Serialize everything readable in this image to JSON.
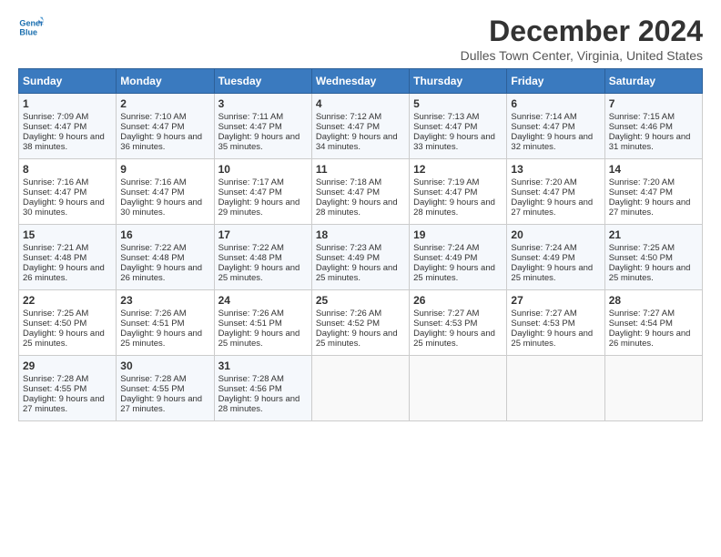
{
  "header": {
    "logo_line1": "General",
    "logo_line2": "Blue",
    "month_title": "December 2024",
    "location": "Dulles Town Center, Virginia, United States"
  },
  "days_of_week": [
    "Sunday",
    "Monday",
    "Tuesday",
    "Wednesday",
    "Thursday",
    "Friday",
    "Saturday"
  ],
  "rows": [
    [
      {
        "day": "1",
        "sunrise": "Sunrise: 7:09 AM",
        "sunset": "Sunset: 4:47 PM",
        "daylight": "Daylight: 9 hours and 38 minutes."
      },
      {
        "day": "2",
        "sunrise": "Sunrise: 7:10 AM",
        "sunset": "Sunset: 4:47 PM",
        "daylight": "Daylight: 9 hours and 36 minutes."
      },
      {
        "day": "3",
        "sunrise": "Sunrise: 7:11 AM",
        "sunset": "Sunset: 4:47 PM",
        "daylight": "Daylight: 9 hours and 35 minutes."
      },
      {
        "day": "4",
        "sunrise": "Sunrise: 7:12 AM",
        "sunset": "Sunset: 4:47 PM",
        "daylight": "Daylight: 9 hours and 34 minutes."
      },
      {
        "day": "5",
        "sunrise": "Sunrise: 7:13 AM",
        "sunset": "Sunset: 4:47 PM",
        "daylight": "Daylight: 9 hours and 33 minutes."
      },
      {
        "day": "6",
        "sunrise": "Sunrise: 7:14 AM",
        "sunset": "Sunset: 4:47 PM",
        "daylight": "Daylight: 9 hours and 32 minutes."
      },
      {
        "day": "7",
        "sunrise": "Sunrise: 7:15 AM",
        "sunset": "Sunset: 4:46 PM",
        "daylight": "Daylight: 9 hours and 31 minutes."
      }
    ],
    [
      {
        "day": "8",
        "sunrise": "Sunrise: 7:16 AM",
        "sunset": "Sunset: 4:47 PM",
        "daylight": "Daylight: 9 hours and 30 minutes."
      },
      {
        "day": "9",
        "sunrise": "Sunrise: 7:16 AM",
        "sunset": "Sunset: 4:47 PM",
        "daylight": "Daylight: 9 hours and 30 minutes."
      },
      {
        "day": "10",
        "sunrise": "Sunrise: 7:17 AM",
        "sunset": "Sunset: 4:47 PM",
        "daylight": "Daylight: 9 hours and 29 minutes."
      },
      {
        "day": "11",
        "sunrise": "Sunrise: 7:18 AM",
        "sunset": "Sunset: 4:47 PM",
        "daylight": "Daylight: 9 hours and 28 minutes."
      },
      {
        "day": "12",
        "sunrise": "Sunrise: 7:19 AM",
        "sunset": "Sunset: 4:47 PM",
        "daylight": "Daylight: 9 hours and 28 minutes."
      },
      {
        "day": "13",
        "sunrise": "Sunrise: 7:20 AM",
        "sunset": "Sunset: 4:47 PM",
        "daylight": "Daylight: 9 hours and 27 minutes."
      },
      {
        "day": "14",
        "sunrise": "Sunrise: 7:20 AM",
        "sunset": "Sunset: 4:47 PM",
        "daylight": "Daylight: 9 hours and 27 minutes."
      }
    ],
    [
      {
        "day": "15",
        "sunrise": "Sunrise: 7:21 AM",
        "sunset": "Sunset: 4:48 PM",
        "daylight": "Daylight: 9 hours and 26 minutes."
      },
      {
        "day": "16",
        "sunrise": "Sunrise: 7:22 AM",
        "sunset": "Sunset: 4:48 PM",
        "daylight": "Daylight: 9 hours and 26 minutes."
      },
      {
        "day": "17",
        "sunrise": "Sunrise: 7:22 AM",
        "sunset": "Sunset: 4:48 PM",
        "daylight": "Daylight: 9 hours and 25 minutes."
      },
      {
        "day": "18",
        "sunrise": "Sunrise: 7:23 AM",
        "sunset": "Sunset: 4:49 PM",
        "daylight": "Daylight: 9 hours and 25 minutes."
      },
      {
        "day": "19",
        "sunrise": "Sunrise: 7:24 AM",
        "sunset": "Sunset: 4:49 PM",
        "daylight": "Daylight: 9 hours and 25 minutes."
      },
      {
        "day": "20",
        "sunrise": "Sunrise: 7:24 AM",
        "sunset": "Sunset: 4:49 PM",
        "daylight": "Daylight: 9 hours and 25 minutes."
      },
      {
        "day": "21",
        "sunrise": "Sunrise: 7:25 AM",
        "sunset": "Sunset: 4:50 PM",
        "daylight": "Daylight: 9 hours and 25 minutes."
      }
    ],
    [
      {
        "day": "22",
        "sunrise": "Sunrise: 7:25 AM",
        "sunset": "Sunset: 4:50 PM",
        "daylight": "Daylight: 9 hours and 25 minutes."
      },
      {
        "day": "23",
        "sunrise": "Sunrise: 7:26 AM",
        "sunset": "Sunset: 4:51 PM",
        "daylight": "Daylight: 9 hours and 25 minutes."
      },
      {
        "day": "24",
        "sunrise": "Sunrise: 7:26 AM",
        "sunset": "Sunset: 4:51 PM",
        "daylight": "Daylight: 9 hours and 25 minutes."
      },
      {
        "day": "25",
        "sunrise": "Sunrise: 7:26 AM",
        "sunset": "Sunset: 4:52 PM",
        "daylight": "Daylight: 9 hours and 25 minutes."
      },
      {
        "day": "26",
        "sunrise": "Sunrise: 7:27 AM",
        "sunset": "Sunset: 4:53 PM",
        "daylight": "Daylight: 9 hours and 25 minutes."
      },
      {
        "day": "27",
        "sunrise": "Sunrise: 7:27 AM",
        "sunset": "Sunset: 4:53 PM",
        "daylight": "Daylight: 9 hours and 25 minutes."
      },
      {
        "day": "28",
        "sunrise": "Sunrise: 7:27 AM",
        "sunset": "Sunset: 4:54 PM",
        "daylight": "Daylight: 9 hours and 26 minutes."
      }
    ],
    [
      {
        "day": "29",
        "sunrise": "Sunrise: 7:28 AM",
        "sunset": "Sunset: 4:55 PM",
        "daylight": "Daylight: 9 hours and 27 minutes."
      },
      {
        "day": "30",
        "sunrise": "Sunrise: 7:28 AM",
        "sunset": "Sunset: 4:55 PM",
        "daylight": "Daylight: 9 hours and 27 minutes."
      },
      {
        "day": "31",
        "sunrise": "Sunrise: 7:28 AM",
        "sunset": "Sunset: 4:56 PM",
        "daylight": "Daylight: 9 hours and 28 minutes."
      },
      null,
      null,
      null,
      null
    ]
  ]
}
